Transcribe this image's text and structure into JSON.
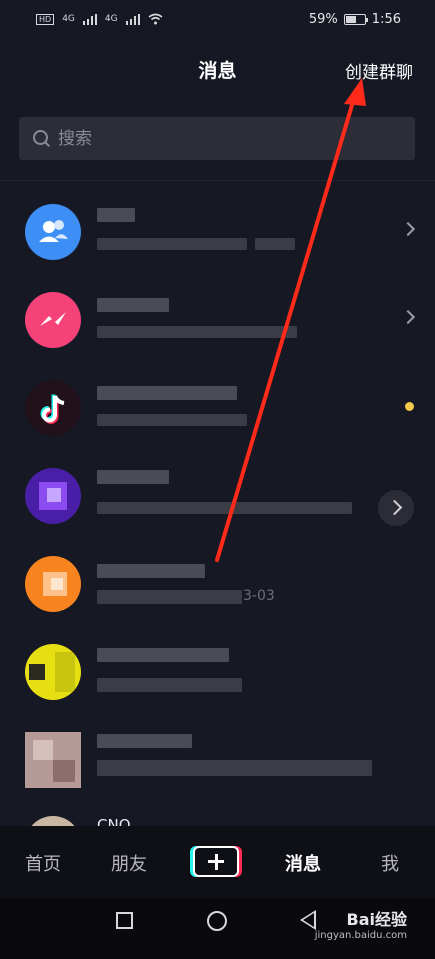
{
  "status_bar": {
    "battery": "59%",
    "time": "1:56",
    "battery_level": 0.59,
    "network": [
      "4G",
      "4G"
    ]
  },
  "header": {
    "title": "消息",
    "create_group": "创建群聊"
  },
  "search": {
    "placeholder": "搜索"
  },
  "list": {
    "row5_visible_text": "3-03",
    "row8_visible_text": "CNQ"
  },
  "bottom_nav": {
    "home": "首页",
    "friends": "朋友",
    "messages": "消息",
    "me": "我"
  },
  "watermark": {
    "brand": "Bai经验",
    "url": "jingyan.baidu.com"
  },
  "colors": {
    "background": "#161823",
    "accent_yellow": "#f2c94c",
    "annotation": "#ff2a1a"
  }
}
